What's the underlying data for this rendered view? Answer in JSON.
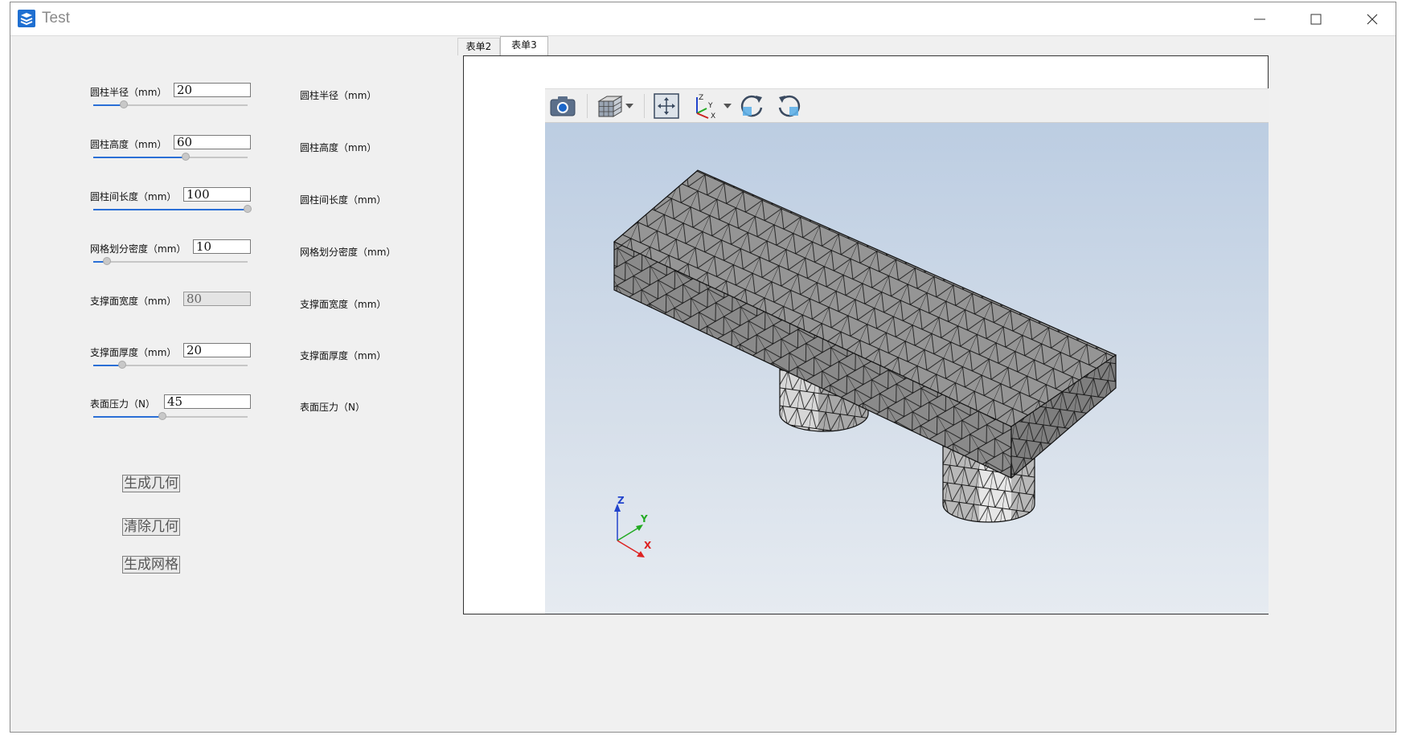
{
  "window": {
    "title": "Test"
  },
  "form": {
    "rows": [
      {
        "label": "圆柱半径（mm）",
        "value": "20",
        "slider": 0.2,
        "readout": "圆柱半径（mm）"
      },
      {
        "label": "圆柱高度（mm）",
        "value": "60",
        "slider": 0.6,
        "readout": "圆柱高度（mm）"
      },
      {
        "label": "圆柱间长度（mm）",
        "value": "100",
        "slider": 1.0,
        "readout": "圆柱间长度（mm）"
      },
      {
        "label": "网格划分密度（mm）",
        "value": "10",
        "slider": 0.09,
        "readout": "网格划分密度（mm）"
      },
      {
        "label": "支撑面宽度（mm）",
        "value": "80",
        "readout": "支撑面宽度（mm）"
      },
      {
        "label": "支撑面厚度（mm）",
        "value": "20",
        "slider": 0.19,
        "readout": "支撑面厚度（mm）"
      },
      {
        "label": "表面压力（N）",
        "value": "45",
        "slider": 0.45,
        "readout": "表面压力（N）"
      }
    ],
    "actions": {
      "generate_geometry": "生成几何",
      "clear_geometry": "清除几何",
      "generate_mesh": "生成网格"
    }
  },
  "tabs": [
    {
      "label": "表单2",
      "active": false
    },
    {
      "label": "表单3",
      "active": true
    }
  ],
  "viewer": {
    "toolbar": [
      "camera-icon",
      "cube-view-icon",
      "fit-view-icon",
      "axes-view-icon",
      "rotate-cw-icon",
      "rotate-ccw-icon"
    ],
    "axis_labels": {
      "x": "X",
      "y": "Y",
      "z": "Z"
    },
    "colors": {
      "accent": "#2a6fd6",
      "mesh_face": "#8e8e8e",
      "mesh_edge": "#1a1a1a",
      "bg_top": "#bccde2",
      "bg_bottom": "#e6ebf1"
    }
  }
}
